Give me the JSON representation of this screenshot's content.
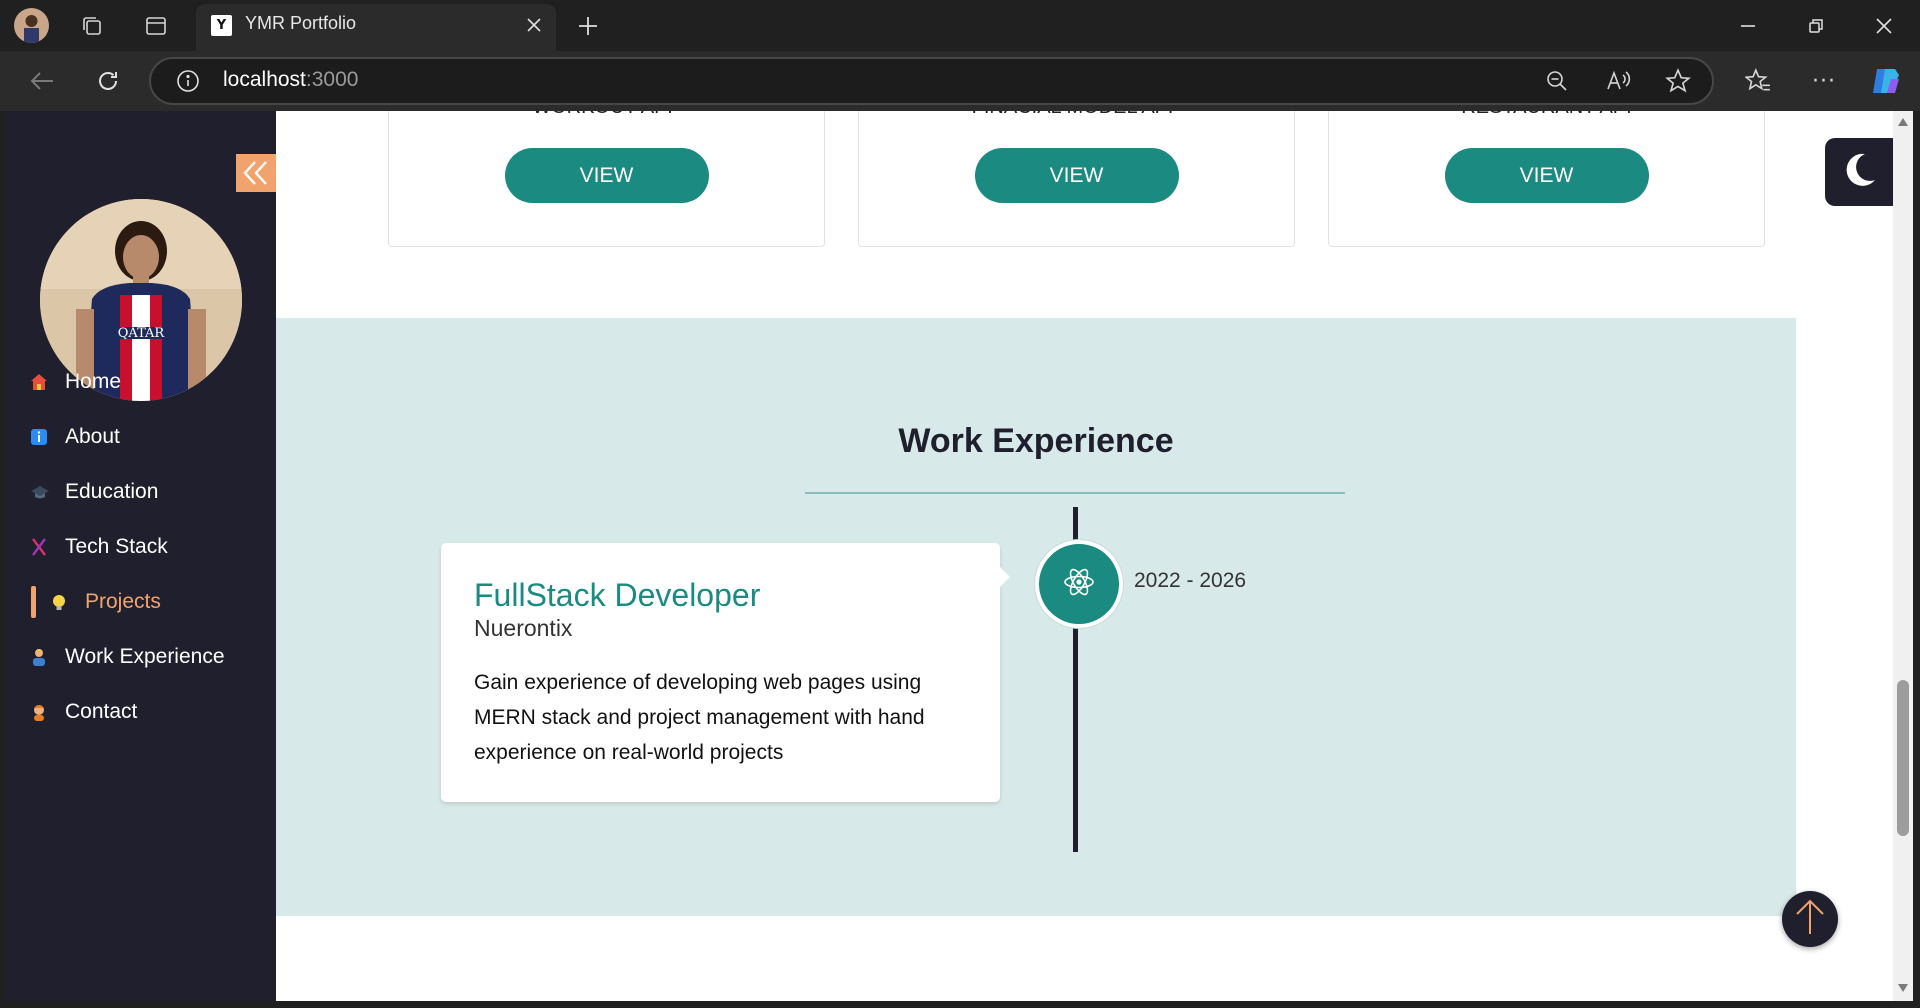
{
  "browser": {
    "tab_title": "YMR Portfolio",
    "tab_favicon_letter": "Y",
    "url_host": "localhost",
    "url_port": ":3000"
  },
  "sidebar": {
    "items": [
      {
        "label": "Home",
        "icon": "house-icon"
      },
      {
        "label": "About",
        "icon": "info-icon"
      },
      {
        "label": "Education",
        "icon": "graduation-cap-icon"
      },
      {
        "label": "Tech Stack",
        "icon": "dna-icon"
      },
      {
        "label": "Projects",
        "icon": "lightbulb-icon",
        "active": true
      },
      {
        "label": "Work Experience",
        "icon": "worker-icon"
      },
      {
        "label": "Contact",
        "icon": "person-icon"
      }
    ],
    "active_color": "#f0a36d"
  },
  "projects": [
    {
      "title": "WORKOUT APP",
      "button": "VIEW"
    },
    {
      "title": "FINACIAL MODEL APP",
      "button": "VIEW"
    },
    {
      "title": "RESTAURANT API",
      "button": "VIEW"
    }
  ],
  "experience": {
    "heading": "Work Experience",
    "items": [
      {
        "role": "FullStack Developer",
        "company": "Nuerontix",
        "date": "2022 - 2026",
        "description": "Gain experience of developing web pages using MERN stack and project management with hand experience on real-world projects",
        "icon": "react-icon"
      }
    ]
  },
  "colors": {
    "accent": "#1b8a80",
    "sidebar_bg": "#1f1f2e",
    "section_bg": "#d7e9e8",
    "orange": "#f0a36d"
  }
}
